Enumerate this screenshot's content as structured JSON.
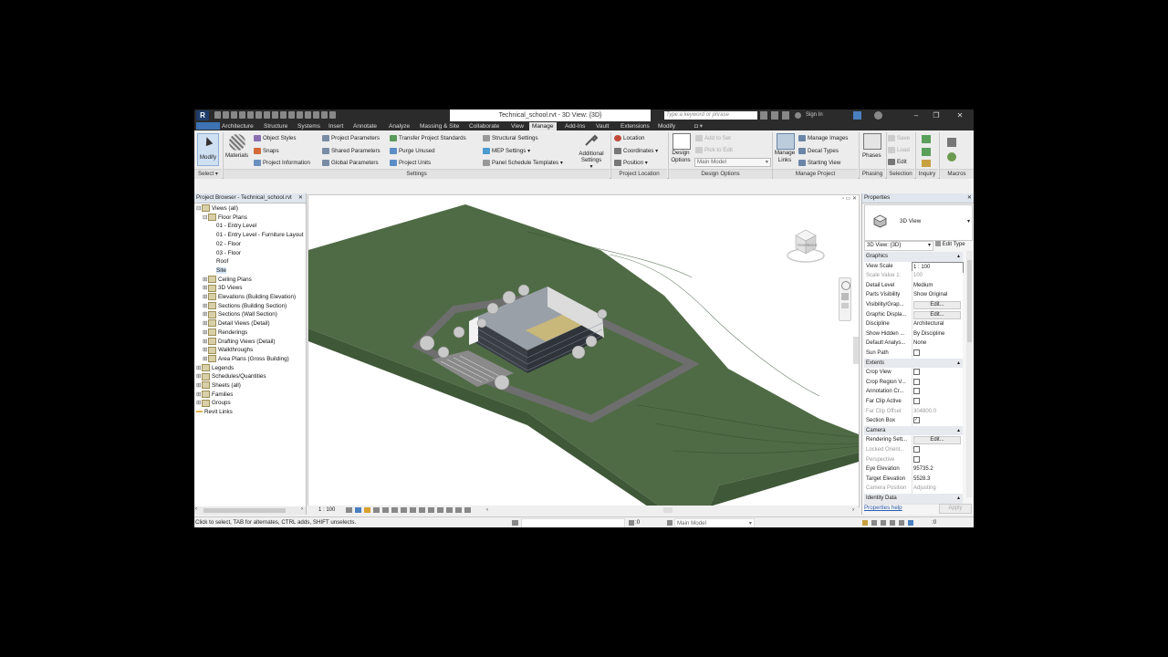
{
  "titlebar": {
    "logo": "R",
    "title": "Technical_school.rvt - 3D View: {3D}",
    "search_placeholder": "Type a keyword or phrase",
    "sign_in": "Sign In"
  },
  "tabs": [
    "Architecture",
    "Structure",
    "Systems",
    "Insert",
    "Annotate",
    "Analyze",
    "Massing & Site",
    "Collaborate",
    "View",
    "Manage",
    "Add-Ins",
    "Vault",
    "Extensions",
    "Modify"
  ],
  "active_tab": "Manage",
  "ribbon": {
    "modify": "Modify",
    "select": "Select",
    "materials": "Materials",
    "object_styles": "Object Styles",
    "snaps": "Snaps",
    "project_information": "Project Information",
    "project_parameters": "Project Parameters",
    "shared_parameters": "Shared Parameters",
    "global_parameters": "Global Parameters",
    "transfer_standards": "Transfer Project Standards",
    "purge_unused": "Purge Unused",
    "project_units": "Project Units",
    "structural_settings": "Structural Settings",
    "mep_settings": "MEP Settings",
    "panel_schedule_templates": "Panel Schedule Templates",
    "additional_settings_1": "Additional",
    "additional_settings_2": "Settings",
    "location": "Location",
    "coordinates": "Coordinates",
    "position": "Position",
    "design_options_1": "Design",
    "design_options_2": "Options",
    "add_to_set": "Add to Set",
    "pick_to_edit": "Pick to Edit",
    "main_model": "Main Model",
    "manage_links_1": "Manage",
    "manage_links_2": "Links",
    "manage_images": "Manage Images",
    "decal_types": "Decal Types",
    "starting_view": "Starting View",
    "phases": "Phases",
    "save": "Save",
    "load": "Load",
    "edit": "Edit",
    "panels": {
      "settings": "Settings",
      "project_location": "Project Location",
      "design_options": "Design Options",
      "manage_project": "Manage Project",
      "phasing": "Phasing",
      "selection": "Selection",
      "inquiry": "Inquiry",
      "macros": "Macros"
    }
  },
  "project_browser": {
    "title": "Project Browser - Technical_school.rvt",
    "items": [
      {
        "toggle": "⊟",
        "label": "Views (all)",
        "indent": 0
      },
      {
        "toggle": "⊟",
        "label": "Floor Plans",
        "indent": 1
      },
      {
        "toggle": "",
        "label": "01 - Entry Level",
        "indent": 2
      },
      {
        "toggle": "",
        "label": "01 - Entry Level - Furniture Layout",
        "indent": 2
      },
      {
        "toggle": "",
        "label": "02 - Floor",
        "indent": 2
      },
      {
        "toggle": "",
        "label": "03 - Floor",
        "indent": 2
      },
      {
        "toggle": "",
        "label": "Roof",
        "indent": 2
      },
      {
        "toggle": "",
        "label": "Site",
        "indent": 2
      },
      {
        "toggle": "⊞",
        "label": "Ceiling Plans",
        "indent": 1
      },
      {
        "toggle": "⊞",
        "label": "3D Views",
        "indent": 1
      },
      {
        "toggle": "⊞",
        "label": "Elevations (Building Elevation)",
        "indent": 1
      },
      {
        "toggle": "⊞",
        "label": "Sections (Building Section)",
        "indent": 1
      },
      {
        "toggle": "⊞",
        "label": "Sections (Wall Section)",
        "indent": 1
      },
      {
        "toggle": "⊞",
        "label": "Detail Views (Detail)",
        "indent": 1
      },
      {
        "toggle": "⊞",
        "label": "Renderings",
        "indent": 1
      },
      {
        "toggle": "⊞",
        "label": "Drafting Views (Detail)",
        "indent": 1
      },
      {
        "toggle": "⊞",
        "label": "Walkthroughs",
        "indent": 1
      },
      {
        "toggle": "⊞",
        "label": "Area Plans (Gross Building)",
        "indent": 1
      },
      {
        "toggle": "⊞",
        "label": "Legends",
        "indent": 0
      },
      {
        "toggle": "⊞",
        "label": "Schedules/Quantities",
        "indent": 0
      },
      {
        "toggle": "⊞",
        "label": "Sheets (all)",
        "indent": 0
      },
      {
        "toggle": "⊞",
        "label": "Families",
        "indent": 0
      },
      {
        "toggle": "⊞",
        "label": "Groups",
        "indent": 0
      },
      {
        "toggle": "",
        "label": "Revit Links",
        "indent": 0,
        "link": true
      }
    ]
  },
  "viewport": {
    "scale": "1 : 100",
    "viewcube_face_front": "FRONT",
    "viewcube_face_right": "RIGHT"
  },
  "properties": {
    "title": "Properties",
    "type_name": "3D View",
    "selector": "3D View: {3D}",
    "edit_type": "Edit Type",
    "rows": [
      {
        "group": true,
        "k": "Graphics"
      },
      {
        "k": "View Scale",
        "v": "1 : 100",
        "boxed": true
      },
      {
        "k": "Scale Value   1:",
        "v": "100",
        "dim": true
      },
      {
        "k": "Detail Level",
        "v": "Medium"
      },
      {
        "k": "Parts Visibility",
        "v": "Show Original"
      },
      {
        "k": "Visibility/Grap...",
        "v": "Edit...",
        "btn": true
      },
      {
        "k": "Graphic Displa...",
        "v": "Edit...",
        "btn": true
      },
      {
        "k": "Discipline",
        "v": "Architectural"
      },
      {
        "k": "Show Hidden ...",
        "v": "By Discipline"
      },
      {
        "k": "Default Analys...",
        "v": "None"
      },
      {
        "k": "Sun Path",
        "cb": true
      },
      {
        "group": true,
        "k": "Extents"
      },
      {
        "k": "Crop View",
        "cb": true
      },
      {
        "k": "Crop Region V...",
        "cb": true
      },
      {
        "k": "Annotation Cr...",
        "cb": true
      },
      {
        "k": "Far Clip Active",
        "cb": true
      },
      {
        "k": "Far Clip Offset",
        "v": "304800.0",
        "dim": true
      },
      {
        "k": "Section Box",
        "cb": true,
        "checked": true
      },
      {
        "group": true,
        "k": "Camera"
      },
      {
        "k": "Rendering Sett...",
        "v": "Edit...",
        "btn": true
      },
      {
        "k": "Locked Orient...",
        "cb": true,
        "dim": true
      },
      {
        "k": "Perspective",
        "cb": true,
        "dim": true
      },
      {
        "k": "Eye Elevation",
        "v": "95735.2"
      },
      {
        "k": "Target Elevation",
        "v": "5528.3"
      },
      {
        "k": "Camera Position",
        "v": "Adjusting",
        "dim": true
      },
      {
        "group": true,
        "k": "Identity Data"
      }
    ],
    "help_link": "Properties help",
    "apply": "Apply"
  },
  "status": {
    "message": "Click to select, TAB for alternates, CTRL adds, SHIFT unselects.",
    "count": ":0",
    "model": "Main Model",
    "filter_count": ":0"
  },
  "colors": {
    "terrain": "#4f6b45",
    "terrain_dark": "#3f5838",
    "road": "#6e6e6e",
    "building_roof": "#9aa0a8",
    "building_wall": "#3a3f46"
  }
}
